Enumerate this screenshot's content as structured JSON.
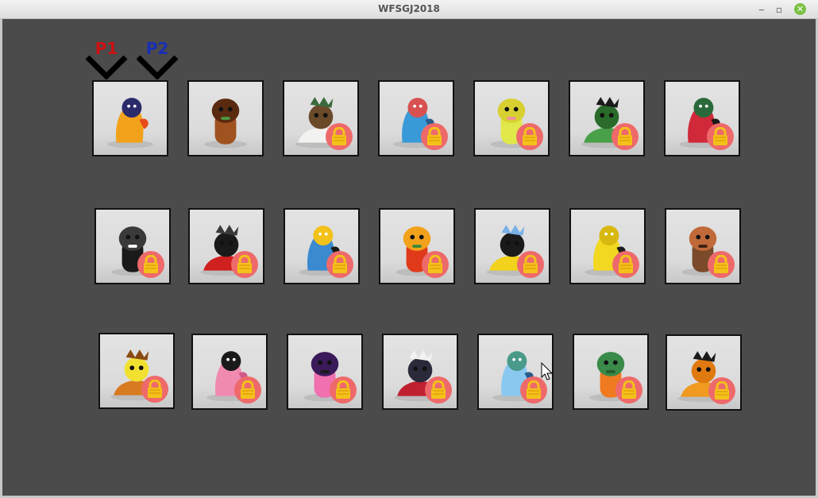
{
  "window": {
    "title": "WFSGJ2018"
  },
  "window_controls": {
    "minimize": "‒",
    "maximize": "▫",
    "close": "✕"
  },
  "selectors": [
    {
      "label": "P1",
      "color": "#cc1111",
      "tile": 0
    },
    {
      "label": "P2",
      "color": "#1a2fb5",
      "tile": 0
    }
  ],
  "colors": {
    "lock_badge": "#ee6a6a",
    "lock_body": "#f3c21a",
    "background": "#4b4b4b"
  },
  "characters": [
    {
      "name": "fire-dragon-character",
      "locked": false,
      "colors": [
        "#f2a11a",
        "#2b2a6b",
        "#e84a1a"
      ]
    },
    {
      "name": "tree-stump-character",
      "locked": false,
      "colors": [
        "#a0521f",
        "#5a2a10",
        "#4a9a45"
      ]
    },
    {
      "name": "duck-and-chef-character",
      "locked": true,
      "colors": [
        "#f2f2f0",
        "#6b4a2a",
        "#3a6a3a"
      ]
    },
    {
      "name": "blue-genie-character",
      "locked": true,
      "colors": [
        "#3a9ad8",
        "#d85050",
        "#2a5a8a"
      ]
    },
    {
      "name": "yellow-block-character",
      "locked": true,
      "colors": [
        "#e0e84a",
        "#d8d030",
        "#f090a0"
      ]
    },
    {
      "name": "green-frog-character",
      "locked": true,
      "colors": [
        "#48a048",
        "#2a6a2a",
        "#1a1a1a"
      ]
    },
    {
      "name": "red-wizard-character",
      "locked": true,
      "colors": [
        "#d02a3a",
        "#2a6a3a",
        "#1a1a1a"
      ]
    },
    {
      "name": "black-creature-character",
      "locked": true,
      "colors": [
        "#1a1a1a",
        "#3a3a3a",
        "#ffffff"
      ]
    },
    {
      "name": "red-hooded-character",
      "locked": true,
      "colors": [
        "#d02020",
        "#1a1a1a",
        "#3a3a3a"
      ]
    },
    {
      "name": "blue-robot-character",
      "locked": true,
      "colors": [
        "#3a8ad0",
        "#f2c21a",
        "#1a1a1a"
      ]
    },
    {
      "name": "angry-apple-character",
      "locked": true,
      "colors": [
        "#e03a1a",
        "#f2a11a",
        "#3a8a3a"
      ]
    },
    {
      "name": "bumble-bee-character",
      "locked": true,
      "colors": [
        "#f2d21a",
        "#1a1a1a",
        "#7ab0e8"
      ]
    },
    {
      "name": "yellow-worm-character",
      "locked": true,
      "colors": [
        "#f2d820",
        "#d8b810",
        "#1a1a1a"
      ]
    },
    {
      "name": "hedgehog-character",
      "locked": true,
      "colors": [
        "#7a4a2a",
        "#c06a3a",
        "#3a2010"
      ]
    },
    {
      "name": "lion-trident-character",
      "locked": true,
      "colors": [
        "#d87a20",
        "#f2e030",
        "#8a4a10"
      ]
    },
    {
      "name": "pink-starfish-character",
      "locked": true,
      "colors": [
        "#f08ab0",
        "#1a1a1a",
        "#d05a8a"
      ]
    },
    {
      "name": "pink-cat-character",
      "locked": true,
      "colors": [
        "#f070b0",
        "#3a1a5a",
        "#1a1a1a"
      ]
    },
    {
      "name": "red-ninja-character",
      "locked": true,
      "colors": [
        "#c02030",
        "#2a2a3a",
        "#f2f2f2"
      ]
    },
    {
      "name": "blue-cat-character",
      "locked": true,
      "colors": [
        "#8ac8f0",
        "#4a9a8a",
        "#2a5a8a"
      ]
    },
    {
      "name": "orange-monster-character",
      "locked": true,
      "colors": [
        "#f07a20",
        "#3a8a4a",
        "#2a5a2a"
      ]
    },
    {
      "name": "orange-snake-character",
      "locked": true,
      "colors": [
        "#f09a20",
        "#e07a10",
        "#1a1a1a"
      ]
    }
  ]
}
